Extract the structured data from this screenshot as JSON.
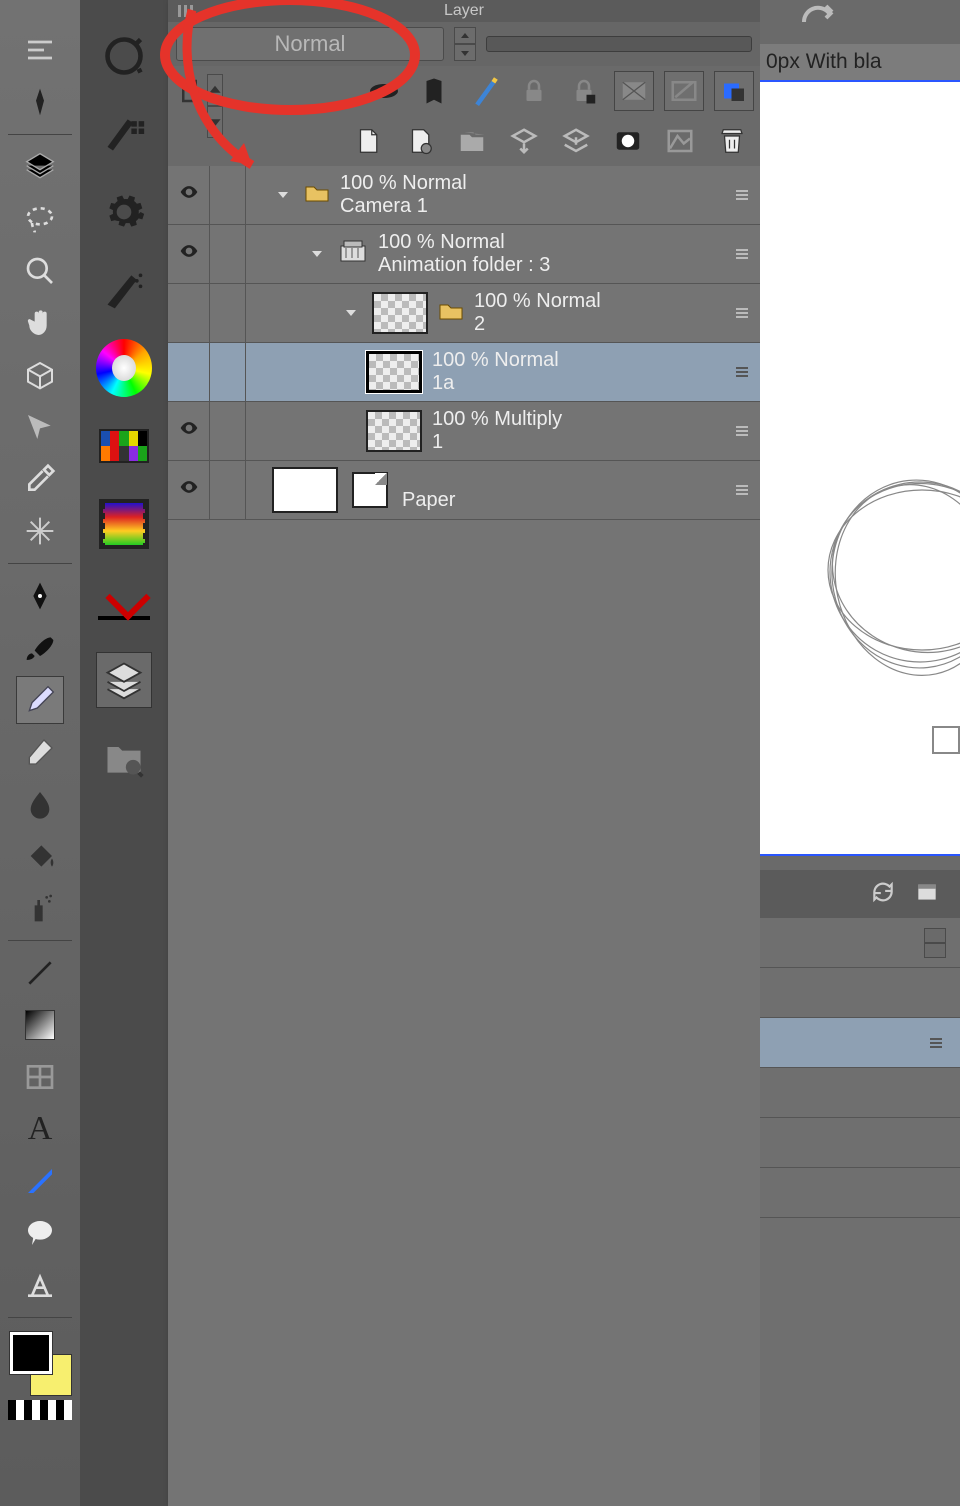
{
  "panel": {
    "title": "Layer"
  },
  "blend": {
    "mode": "Normal"
  },
  "status": {
    "text": "0px With bla"
  },
  "layers": [
    {
      "id": "camera",
      "opacity": "100 %",
      "mode": "Normal",
      "name": "Camera 1",
      "indent": 0,
      "kind": "folder",
      "thumb": "none",
      "selected": false,
      "visible": true
    },
    {
      "id": "anim",
      "opacity": "100 %",
      "mode": "Normal",
      "name": "Animation folder : 3",
      "indent": 1,
      "kind": "anim",
      "thumb": "none",
      "selected": false,
      "visible": true
    },
    {
      "id": "two",
      "opacity": "100 %",
      "mode": "Normal",
      "name": "2",
      "indent": 2,
      "kind": "folder2",
      "thumb": "check",
      "selected": false,
      "visible": false
    },
    {
      "id": "onea",
      "opacity": "100 %",
      "mode": "Normal",
      "name": "1a",
      "indent": 2,
      "kind": "raster",
      "thumb": "check",
      "selected": true,
      "visible": false
    },
    {
      "id": "one",
      "opacity": "100 %",
      "mode": "Multiply",
      "name": "1",
      "indent": 2,
      "kind": "raster",
      "thumb": "check",
      "selected": false,
      "visible": true
    },
    {
      "id": "paper",
      "opacity": "",
      "mode": "",
      "name": "Paper",
      "indent": 0,
      "kind": "paper",
      "thumb": "white",
      "selected": false,
      "visible": true
    }
  ]
}
